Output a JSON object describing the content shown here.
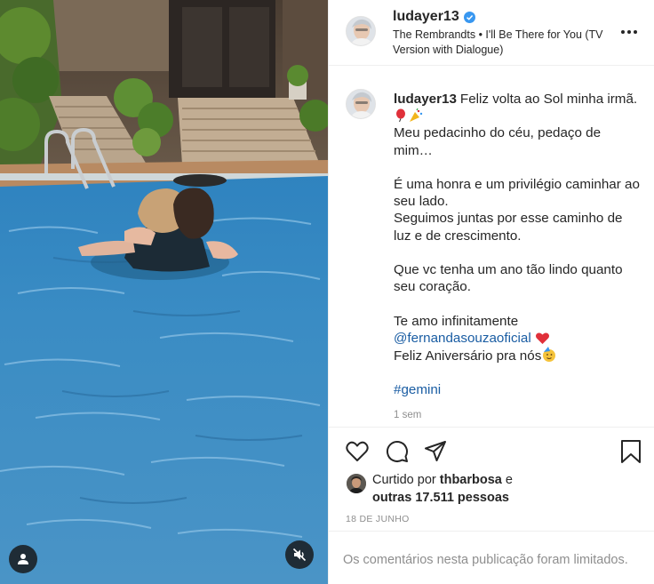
{
  "post": {
    "username": "ludayer13",
    "verified": true,
    "audio": "The Rembrandts • I'll Be There for You (TV Version with Dialogue)",
    "more_icon": "more-horizontal-icon",
    "caption": {
      "username": "ludayer13",
      "lines": [
        "Feliz volta ao Sol minha irmã.",
        "Meu pedacinho do céu, pedaço de mim…",
        "É uma honra e um privilégio caminhar ao seu lado.",
        "Seguimos juntas por esse caminho de luz e de crescimento.",
        "Que vc tenha um ano tão lindo quanto seu coração.",
        "Te amo infinitamente",
        "@fernandasouzaoficial",
        "Feliz Aniversário pra nós",
        "#gemini"
      ],
      "emojis": [
        "balloon-icon",
        "party-popper-icon",
        "red-heart-icon",
        "partying-face-icon"
      ]
    },
    "time_ago": "1 sem",
    "actions": {
      "like_icon": "heart-icon",
      "comment_icon": "comment-icon",
      "share_icon": "send-icon",
      "save_icon": "bookmark-icon"
    },
    "likes": {
      "prefix": "Curtido por",
      "user": "thbarbosa",
      "conj": "e",
      "others": "outras 17.511 pessoas"
    },
    "date": "18 DE JUNHO",
    "comments_notice": "Os comentários nesta publicação foram limitados."
  },
  "media": {
    "user_tag_icon": "user-tag-icon",
    "mute_icon": "speaker-muted-icon"
  },
  "colors": {
    "link": "#1a5da3",
    "secondary_text": "#8e8e8e",
    "verified_blue": "#3897f0",
    "border": "#efefef",
    "pool_water": "#3d86b8"
  }
}
